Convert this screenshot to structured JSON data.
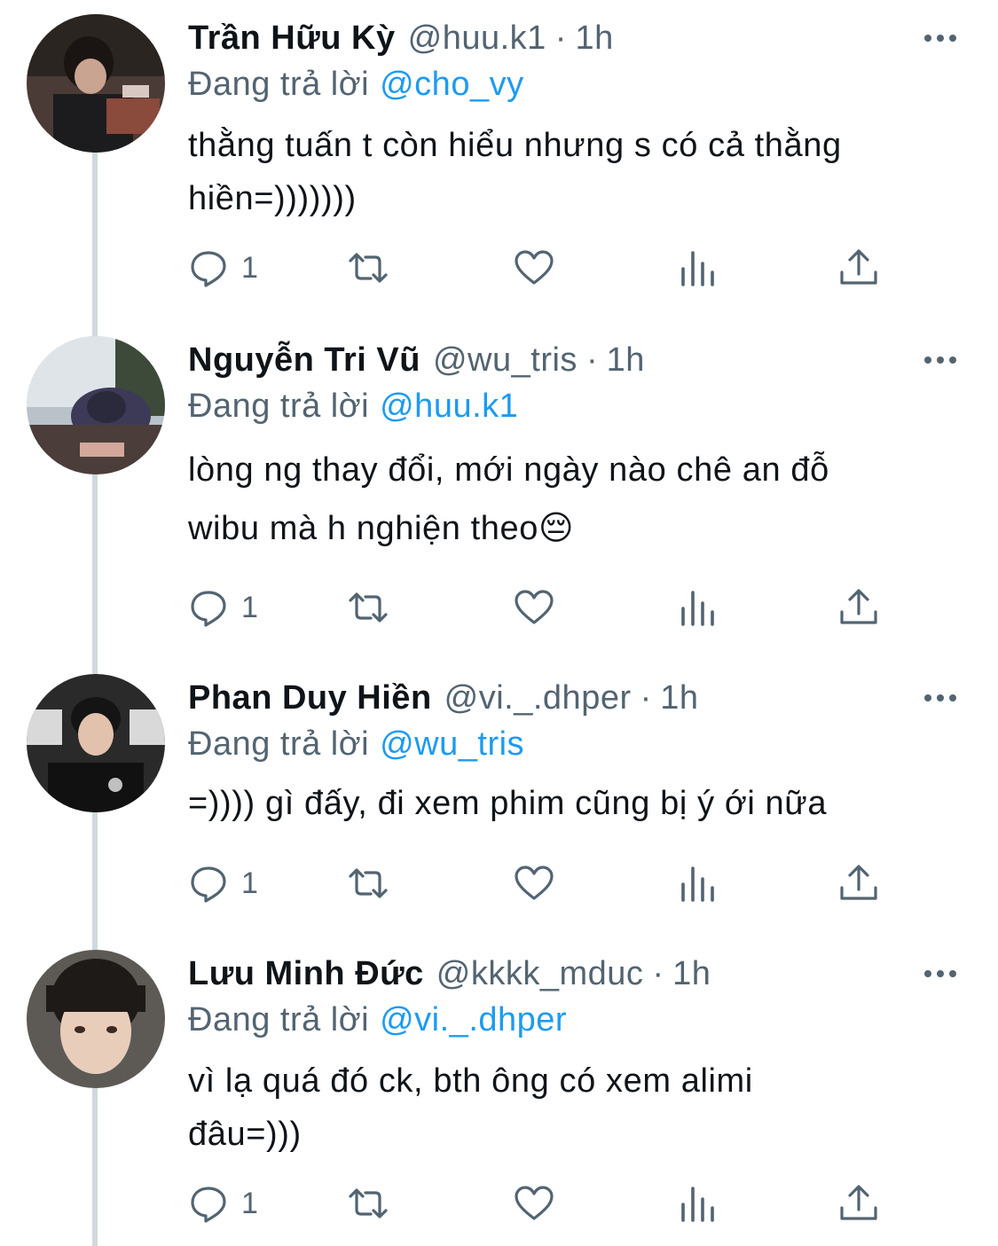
{
  "thread": {
    "reply_prefix": "Đang trả lời",
    "tweets": [
      {
        "name": "Trần Hữu Kỳ",
        "handle": "@huu.k1",
        "time": "1h",
        "reply_to": "@cho_vy",
        "text": "thằng tuấn t còn hiểu nhưng s có cả thằng\nhiền=)))))))",
        "reply_count": "1"
      },
      {
        "name": "Nguyễn Tri Vũ",
        "handle": "@wu_tris",
        "time": "1h",
        "reply_to": "@huu.k1",
        "text": "lòng ng thay đổi, mới ngày nào chê an đỗ\nwibu mà h nghiện theo😔",
        "reply_count": "1"
      },
      {
        "name": "Phan Duy Hiền",
        "handle": "@vi._.dhper",
        "time": "1h",
        "reply_to": "@wu_tris",
        "text": "=)))) gì đấy, đi xem phim cũng bị ý ới nữa",
        "reply_count": "1"
      },
      {
        "name": "Lưu Minh Đức",
        "handle": "@kkkk_mduc",
        "time": "1h",
        "reply_to": "@vi._.dhper",
        "text": "vì lạ quá đó ck, bth ông có xem alimi\nđâu=)))",
        "reply_count": "1"
      }
    ]
  },
  "icons": {
    "reply": "comment-bubble-icon",
    "retweet": "retweet-icon",
    "like": "heart-icon",
    "analytics": "bar-chart-icon",
    "share": "share-upload-icon",
    "more": "more-dots-icon"
  },
  "colors": {
    "name": "#0f1419",
    "secondary": "#536471",
    "mention": "#1d9bf0",
    "thread_line": "#cfd9de"
  }
}
